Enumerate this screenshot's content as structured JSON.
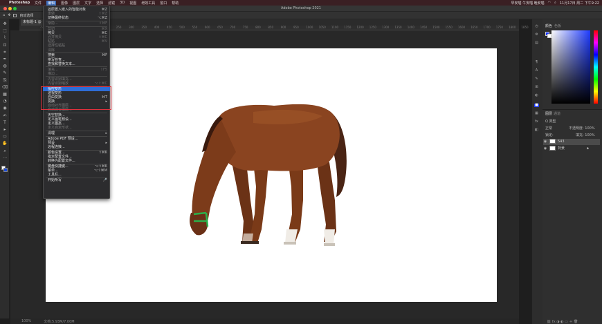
{
  "menubar": {
    "apple": "",
    "app_name": "Photoshop",
    "items": [
      "文件",
      "编辑",
      "图像",
      "图层",
      "文字",
      "选择",
      "滤镜",
      "3D",
      "视图",
      "增效工具",
      "窗口",
      "帮助"
    ],
    "active_index": 1,
    "right_text": "早安喵 午安喵 晚安喵",
    "clock": "11月17日 周二 下午9:22"
  },
  "titlebar": {
    "title": "Adobe Photoshop 2021"
  },
  "options": {
    "auto_select_label": "自动选择"
  },
  "document": {
    "tab": "未标题-1 @",
    "zoom": "100%",
    "doc_info": "文档:5.93M/7.00M"
  },
  "ruler_ticks": [
    "-50",
    "0",
    "50",
    "100",
    "150",
    "200",
    "250",
    "300",
    "350",
    "400",
    "450",
    "500",
    "550",
    "600",
    "650",
    "700",
    "750",
    "800",
    "850",
    "900",
    "950",
    "1000",
    "1050",
    "1100",
    "1150",
    "1200",
    "1250",
    "1300",
    "1350",
    "1400",
    "1450",
    "1500",
    "1550",
    "1600",
    "1650",
    "1700",
    "1750",
    "1800",
    "1850"
  ],
  "menu": {
    "items": [
      {
        "label": "还原置入嵌入的智能对象",
        "shortcut": "⌘Z",
        "disabled": false
      },
      {
        "label": "重做",
        "shortcut": "⇧⌘Z",
        "disabled": true
      },
      {
        "label": "切换最终状态",
        "shortcut": "⌥⌘Z",
        "disabled": false
      },
      {
        "label": "渐隐...",
        "shortcut": "⇧⌘F",
        "disabled": true
      },
      {
        "label": "剪切",
        "shortcut": "⌘X",
        "disabled": true
      },
      {
        "label": "拷贝",
        "shortcut": "⌘C",
        "disabled": false
      },
      {
        "label": "合并拷贝",
        "shortcut": "⇧⌘C",
        "disabled": true
      },
      {
        "label": "粘贴",
        "shortcut": "⌘V",
        "disabled": true
      },
      {
        "label": "选择性粘贴",
        "shortcut": "",
        "disabled": true
      },
      {
        "label": "清除",
        "shortcut": "",
        "disabled": true
      },
      {
        "label": "搜索",
        "shortcut": "⌘F",
        "disabled": false
      },
      {
        "label": "拼写检查...",
        "shortcut": "",
        "disabled": false
      },
      {
        "label": "查找和替换文本...",
        "shortcut": "",
        "disabled": false
      },
      {
        "label": "填充...",
        "shortcut": "⇧F5",
        "disabled": true
      },
      {
        "label": "描边...",
        "shortcut": "",
        "disabled": true
      },
      {
        "label": "内容识别填充...",
        "shortcut": "",
        "disabled": true
      },
      {
        "label": "内容识别缩放",
        "shortcut": "⌥⇧⌘C",
        "disabled": true
      },
      {
        "label": "操控变形",
        "shortcut": "",
        "disabled": false
      },
      {
        "label": "透视变形",
        "shortcut": "",
        "disabled": false
      },
      {
        "label": "自由变换",
        "shortcut": "⌘T",
        "disabled": false
      },
      {
        "label": "变换",
        "shortcut": "▸",
        "disabled": false
      },
      {
        "label": "自动对齐图层...",
        "shortcut": "",
        "disabled": true
      },
      {
        "label": "自动混合图层...",
        "shortcut": "",
        "disabled": true
      },
      {
        "label": "天空替换...",
        "shortcut": "",
        "disabled": false
      },
      {
        "label": "定义画笔预设...",
        "shortcut": "",
        "disabled": false
      },
      {
        "label": "定义图案...",
        "shortcut": "",
        "disabled": false
      },
      {
        "label": "定义自定形状...",
        "shortcut": "",
        "disabled": true
      },
      {
        "label": "清理",
        "shortcut": "▸",
        "disabled": false
      },
      {
        "label": "Adobe PDF 预设...",
        "shortcut": "",
        "disabled": false
      },
      {
        "label": "预设",
        "shortcut": "▸",
        "disabled": false
      },
      {
        "label": "远程连接...",
        "shortcut": "",
        "disabled": false
      },
      {
        "label": "颜色设置...",
        "shortcut": "⇧⌘K",
        "disabled": false
      },
      {
        "label": "指定配置文件...",
        "shortcut": "",
        "disabled": false
      },
      {
        "label": "转换为配置文件...",
        "shortcut": "",
        "disabled": false
      },
      {
        "label": "键盘快捷键...",
        "shortcut": "⌥⇧⌘K",
        "disabled": false
      },
      {
        "label": "菜单...",
        "shortcut": "⌥⇧⌘M",
        "disabled": false
      },
      {
        "label": "工具栏...",
        "shortcut": "",
        "disabled": false
      },
      {
        "label": "开始听写",
        "shortcut": "🎤",
        "disabled": false
      }
    ],
    "highlighted_index": 17
  },
  "panels": {
    "color_tab": "颜色",
    "swatches_tab": "色板",
    "layers_tab": "图层",
    "channels_tab": "通道",
    "kind_label": "Q 类型",
    "blend_mode": "正常",
    "opacity_label": "不透明度: 100%",
    "lock_label": "锁定:",
    "fill_label": "填充: 100%",
    "layers": [
      {
        "name": "543",
        "selected": true
      },
      {
        "name": "背景",
        "selected": false
      }
    ]
  },
  "colors": {
    "accent": "#2f6dd6",
    "highlight_box": "#e0313d",
    "fg_color": "#1f3cff"
  }
}
